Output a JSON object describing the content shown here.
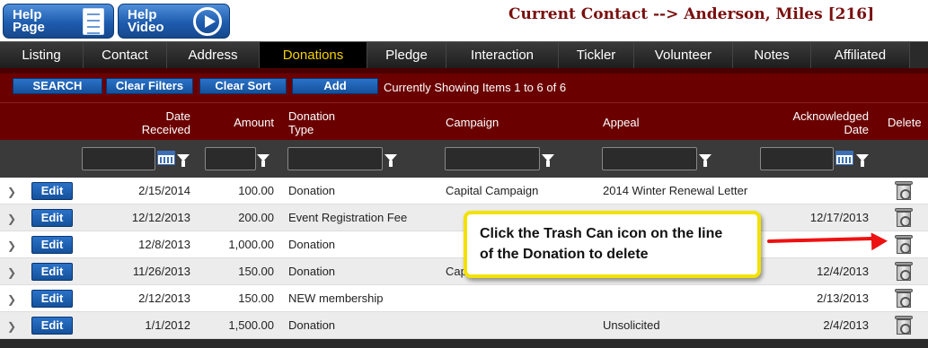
{
  "help": {
    "page": [
      "Help",
      "Page"
    ],
    "video": [
      "Help",
      "Video"
    ]
  },
  "contact_title": "Current Contact --> Anderson, Miles [216]",
  "tabs": [
    {
      "label": "Listing",
      "active": false
    },
    {
      "label": "Contact",
      "active": false
    },
    {
      "label": "Address",
      "active": false
    },
    {
      "label": "Donations",
      "active": true
    },
    {
      "label": "Pledge",
      "active": false
    },
    {
      "label": "Interaction",
      "active": false
    },
    {
      "label": "Tickler",
      "active": false
    },
    {
      "label": "Volunteer",
      "active": false
    },
    {
      "label": "Notes",
      "active": false
    },
    {
      "label": "Affiliated",
      "active": false
    }
  ],
  "toolbar": {
    "search_label": "SEARCH",
    "clear_filters_label": "Clear Filters",
    "clear_sort_label": "Clear Sort",
    "add_label": "Add",
    "showing_text": "Currently Showing Items 1 to 6 of 6"
  },
  "columns": {
    "date_received": [
      "Date",
      "Received"
    ],
    "amount": "Amount",
    "donation_type": [
      "Donation",
      "Type"
    ],
    "campaign": "Campaign",
    "appeal": "Appeal",
    "acknowledged_date": [
      "Acknowledged",
      "Date"
    ],
    "delete": "Delete"
  },
  "edit_label": "Edit",
  "rows": [
    {
      "date": "2/15/2014",
      "amount": "100.00",
      "type": "Donation",
      "campaign": "Capital Campaign",
      "appeal": "2014 Winter Renewal Letter",
      "ack": ""
    },
    {
      "date": "12/12/2013",
      "amount": "200.00",
      "type": "Event Registration Fee",
      "campaign": "",
      "appeal": "",
      "ack": "12/17/2013"
    },
    {
      "date": "12/8/2013",
      "amount": "1,000.00",
      "type": "Donation",
      "campaign": "",
      "appeal": "",
      "ack": ""
    },
    {
      "date": "11/26/2013",
      "amount": "150.00",
      "type": "Donation",
      "campaign": "Cap",
      "appeal": "",
      "ack": "12/4/2013"
    },
    {
      "date": "2/12/2013",
      "amount": "150.00",
      "type": "NEW membership",
      "campaign": "",
      "appeal": "",
      "ack": "2/13/2013"
    },
    {
      "date": "1/1/2012",
      "amount": "1,500.00",
      "type": "Donation",
      "campaign": "",
      "appeal": "Unsolicited",
      "ack": "2/4/2013"
    }
  ],
  "callout": [
    "Click the Trash Can icon on the line",
    "of the Donation to delete"
  ],
  "colors": {
    "maroon": "#6b0000",
    "active_tab_text": "#f5d000",
    "button_blue": "#1e5cae",
    "callout_border": "#f2e200",
    "arrow": "#ee1111"
  }
}
